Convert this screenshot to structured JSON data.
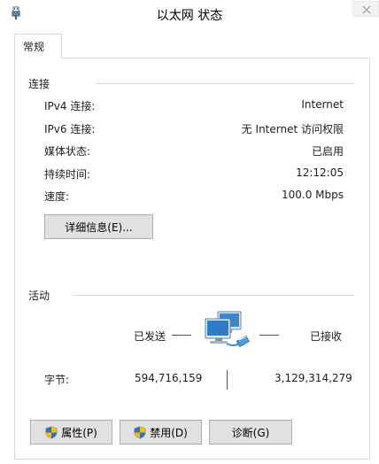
{
  "window": {
    "title": "以太网 状态"
  },
  "tabs": [
    {
      "label": "常规"
    }
  ],
  "connection": {
    "section_title": "连接",
    "rows": [
      {
        "label": "IPv4 连接:",
        "value": "Internet"
      },
      {
        "label": "IPv6 连接:",
        "value": "无 Internet 访问权限"
      },
      {
        "label": "媒体状态:",
        "value": "已启用"
      },
      {
        "label": "持续时间:",
        "value": "12:12:05"
      },
      {
        "label": "速度:",
        "value": "100.0 Mbps"
      }
    ],
    "details_button": "详细信息(E)..."
  },
  "activity": {
    "section_title": "活动",
    "sent_label": "已发送",
    "received_label": "已接收",
    "bytes_label": "字节:",
    "bytes_sent": "594,716,159",
    "bytes_received": "3,129,314,279"
  },
  "buttons": {
    "properties": "属性(P)",
    "disable": "禁用(D)",
    "diagnose": "诊断(G)"
  },
  "icons": {
    "title_icon": "network-adapter-icon",
    "network_icon": "network-computers-icon",
    "shield_icon": "uac-shield-icon",
    "close_icon": "close-icon"
  }
}
